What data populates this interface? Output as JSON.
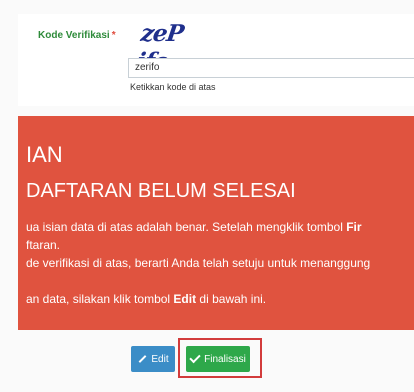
{
  "form": {
    "label": "Kode Verifikasi",
    "required_mark": "*",
    "captcha_text": "zeP ifo",
    "input_value": "zerifo",
    "hint": "Ketikkan kode di atas"
  },
  "alert": {
    "title": "IAN",
    "subtitle": "DAFTARAN BELUM SELESAI",
    "line1_prefix": "ua isian data di atas adalah benar. Setelah mengklik tombol ",
    "line1_bold": "Fir",
    "line2": "ftaran.",
    "line3": "de verifikasi di atas, berarti Anda telah setuju untuk menanggung",
    "line4_prefix": "an data, silakan klik tombol ",
    "line4_bold": "Edit",
    "line4_suffix": " di bawah ini."
  },
  "actions": {
    "edit_label": "Edit",
    "finalize_label": "Finalisasi"
  },
  "colors": {
    "alert_bg": "#e0533f",
    "edit_btn": "#3b8dc7",
    "finalize_btn": "#2ea84a",
    "highlight_border": "#d23b3b",
    "label_green": "#2e8b3a",
    "captcha_blue": "#1f2f8c"
  },
  "icons": {
    "edit": "pencil-icon",
    "finalize": "check-icon"
  }
}
